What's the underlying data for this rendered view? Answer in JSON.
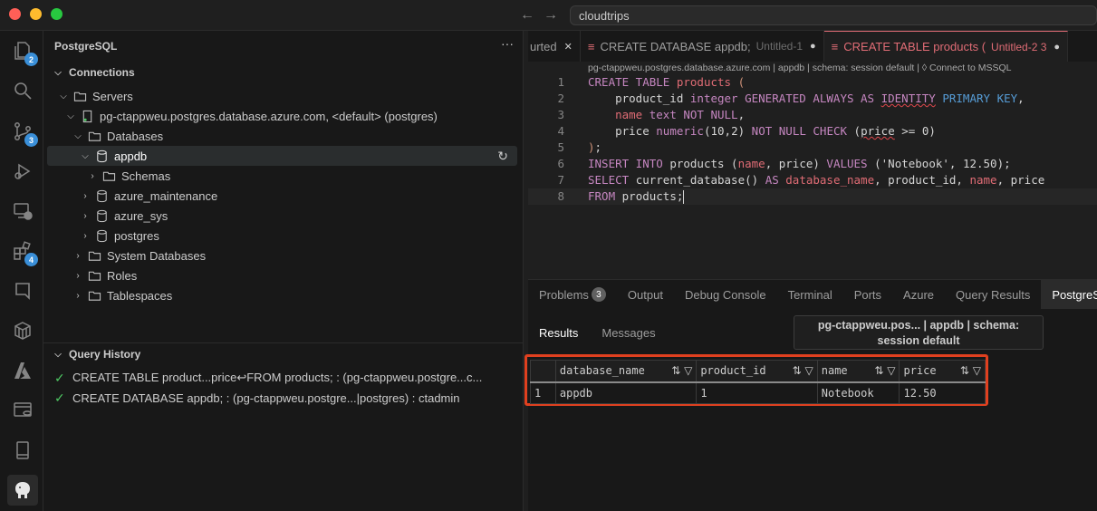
{
  "window": {
    "search_text": "cloudtrips"
  },
  "activity_bar": {
    "items": [
      {
        "icon": "files-icon",
        "badge": "2"
      },
      {
        "icon": "search-icon",
        "badge": ""
      },
      {
        "icon": "source-control-icon",
        "badge": "3"
      },
      {
        "icon": "run-debug-icon",
        "badge": ""
      },
      {
        "icon": "remote-explorer-icon",
        "badge": ""
      },
      {
        "icon": "extensions-icon",
        "badge": "4"
      },
      {
        "icon": "bookmark-icon",
        "badge": ""
      },
      {
        "icon": "containers-icon",
        "badge": ""
      },
      {
        "icon": "azure-icon",
        "badge": ""
      },
      {
        "icon": "database-server-icon",
        "badge": ""
      },
      {
        "icon": "mobile-icon",
        "badge": ""
      },
      {
        "icon": "postgresql-elephant-icon",
        "badge": ""
      }
    ]
  },
  "sidebar": {
    "title": "PostgreSQL",
    "more": "···",
    "connections_label": "Connections",
    "tree": [
      {
        "label": "Servers"
      },
      {
        "label": "pg-ctappweu.postgres.database.azure.com, <default> (postgres)"
      },
      {
        "label": "Databases"
      },
      {
        "label": "appdb"
      },
      {
        "label": "Schemas"
      },
      {
        "label": "azure_maintenance"
      },
      {
        "label": "azure_sys"
      },
      {
        "label": "postgres"
      },
      {
        "label": "System Databases"
      },
      {
        "label": "Roles"
      },
      {
        "label": "Tablespaces"
      }
    ],
    "query_history_label": "Query History",
    "history": [
      "CREATE TABLE product...price↩FROM products; : (pg-ctappweu.postgre...c...",
      "CREATE DATABASE appdb; : (pg-ctappweu.postgre...|postgres) : ctadmin"
    ]
  },
  "editor": {
    "tabs": [
      {
        "label": "urted",
        "sub": "",
        "close": "✕"
      },
      {
        "label": "CREATE DATABASE appdb;",
        "sub": "Untitled-1",
        "close": "●"
      },
      {
        "label": "CREATE TABLE products (",
        "sub": "Untitled-2 3",
        "close": "●"
      }
    ],
    "breadcrumb": "pg-ctappweu.postgres.database.azure.com | appdb | schema: session default | ◊ Connect to MSSQL",
    "line_numbers": [
      "1",
      "2",
      "3",
      "4",
      "5",
      "6",
      "7",
      "8"
    ]
  },
  "panel": {
    "tabs": [
      {
        "label": "Problems",
        "badge": "3"
      },
      {
        "label": "Output"
      },
      {
        "label": "Debug Console"
      },
      {
        "label": "Terminal"
      },
      {
        "label": "Ports"
      },
      {
        "label": "Azure"
      },
      {
        "label": "Query Results"
      },
      {
        "label": "PostgreSQL"
      }
    ],
    "result_tabs": [
      "Results",
      "Messages"
    ],
    "connection_line1": "pg-ctappweu.pos... | appdb | schema:",
    "connection_line2": "session default",
    "grid": {
      "columns": [
        "database_name",
        "product_id",
        "name",
        "price"
      ],
      "rows": [
        {
          "num": "1",
          "cells": [
            "appdb",
            "1",
            "Notebook",
            "12.50"
          ]
        }
      ]
    }
  }
}
